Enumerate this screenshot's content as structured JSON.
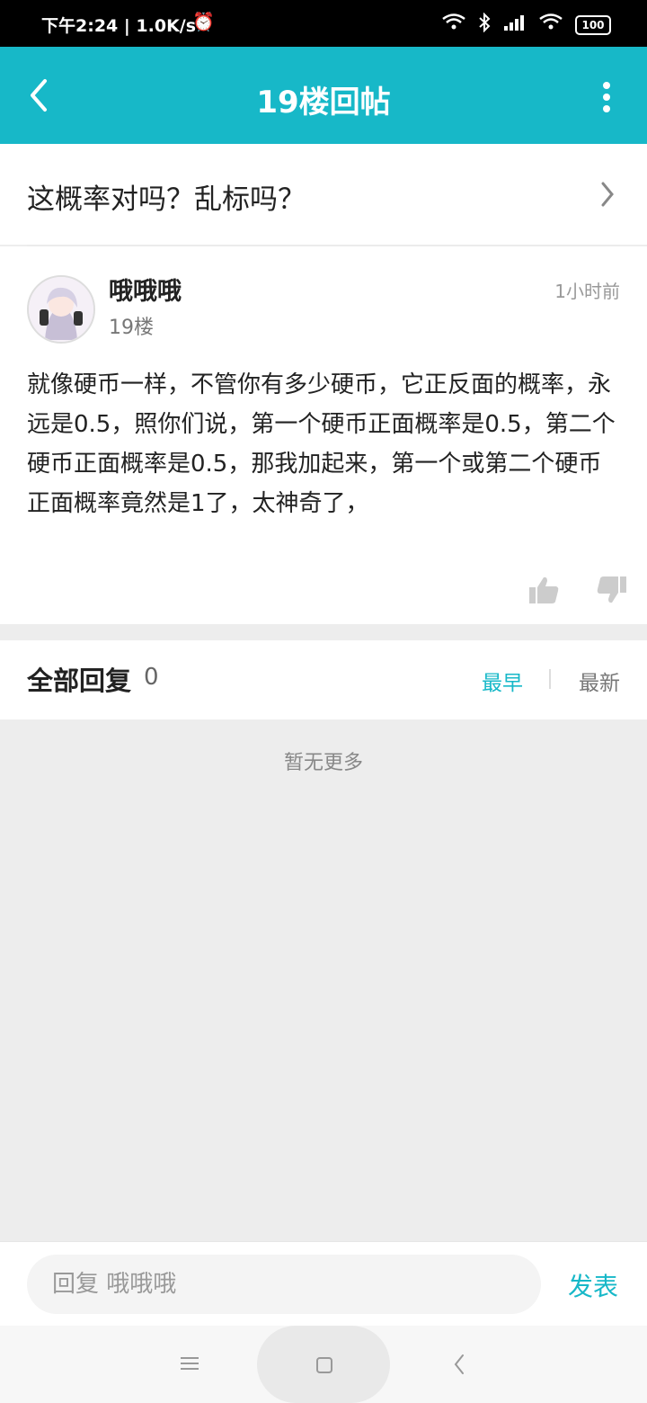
{
  "status_bar": {
    "time_speed": "下午2:24 | 1.0K/s",
    "alarm_icon": "alarm-icon",
    "icons": [
      "wifi-icon",
      "bluetooth-icon",
      "signal-icon",
      "wifi-icon"
    ],
    "battery": "100"
  },
  "app_bar": {
    "title": "19楼回帖",
    "back_icon": "back-arrow-icon",
    "more_icon": "more-vertical-icon"
  },
  "thread": {
    "title": "这概率对吗？乱标吗？"
  },
  "post": {
    "username": "哦哦哦",
    "floor": "19楼",
    "time": "1小时前",
    "content": "就像硬币一样，不管你有多少硬币，它正反面的概率，永远是0.5，照你们说，第一个硬币正面概率是0.5，第二个硬币正面概率是0.5，那我加起来，第一个或第二个硬币正面概率竟然是1了，太神奇了，"
  },
  "replies": {
    "title": "全部回复",
    "count": "0",
    "sort_earliest": "最早",
    "sort_newest": "最新",
    "empty_text": "暂无更多"
  },
  "compose": {
    "placeholder": "回复 哦哦哦",
    "submit": "发表"
  },
  "colors": {
    "accent": "#17b8c8",
    "background": "#ededed"
  }
}
